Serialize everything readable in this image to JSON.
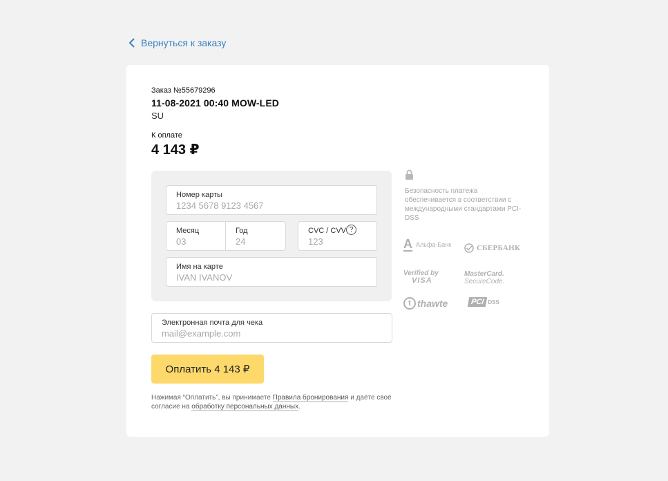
{
  "back_link": {
    "label": "Вернуться к заказу",
    "icon": "chevron-left-icon"
  },
  "order": {
    "number_label": "Заказ №55679296",
    "route": "11-08-2021 00:40 MOW-LED",
    "sub": "SU",
    "due_label": "К оплате",
    "due_amount": "4 143 ₽"
  },
  "form": {
    "card_number": {
      "label": "Номер карты",
      "placeholder": "1234 5678 9123 4567"
    },
    "month": {
      "label": "Месяц",
      "placeholder": "03"
    },
    "year": {
      "label": "Год",
      "placeholder": "24"
    },
    "cvc": {
      "label": "CVC / CVV",
      "placeholder": "123",
      "help": "?"
    },
    "name": {
      "label": "Имя на карте",
      "placeholder": "IVAN IVANOV"
    },
    "email": {
      "label": "Электронная почта для чека",
      "placeholder": "mail@example.com"
    }
  },
  "pay_button": {
    "label": "Оплатить 4 143 ₽"
  },
  "terms": {
    "part1": "Нажимая “Оплатить”, вы принимаете ",
    "link1": "Правила бронирования",
    "part2": " и даёте своё согласие на ",
    "link2": "обработку персональных данных",
    "part3": "."
  },
  "security": {
    "icon": "lock-icon",
    "text": "Безопасность платежа обеспечивается в соответствии с международными стандартами PCI-DSS"
  },
  "logos": {
    "alfa_letter": "А",
    "alfa_name": "Альфа-Банк",
    "sber": "СБЕРБАНК",
    "visa_line1": "Verified by",
    "visa_line2": "VISA",
    "mc_line1": "MasterCard.",
    "mc_line2": "SecureCode.",
    "thawte_t": "t",
    "thawte_name": "thawte",
    "pci": "PCI",
    "dss": "DSS"
  },
  "colors": {
    "background": "#f2f2f2",
    "accent_link": "#3b82c4",
    "pay_button": "#fdd96b"
  }
}
